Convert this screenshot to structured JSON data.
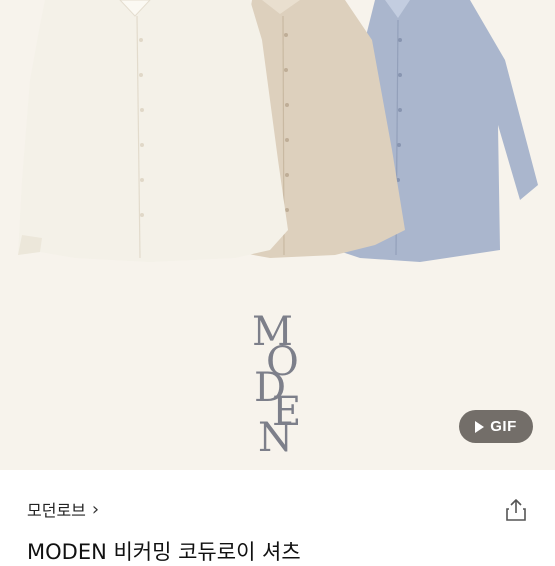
{
  "product_image": {
    "logo_letters": [
      "M",
      "O",
      "D",
      "E",
      "N"
    ],
    "gif_badge_label": "GIF",
    "colors": {
      "background": "#f7f3ec",
      "shirt_ivory": "#f4f1e8",
      "shirt_beige": "#dccfbd",
      "shirt_blue": "#a9b6cf"
    }
  },
  "shop": {
    "name": "모던로브",
    "chevron": "›"
  },
  "share_icon": "share-icon",
  "product": {
    "title": "MODEN 비커밍 코듀로이 셔츠"
  }
}
